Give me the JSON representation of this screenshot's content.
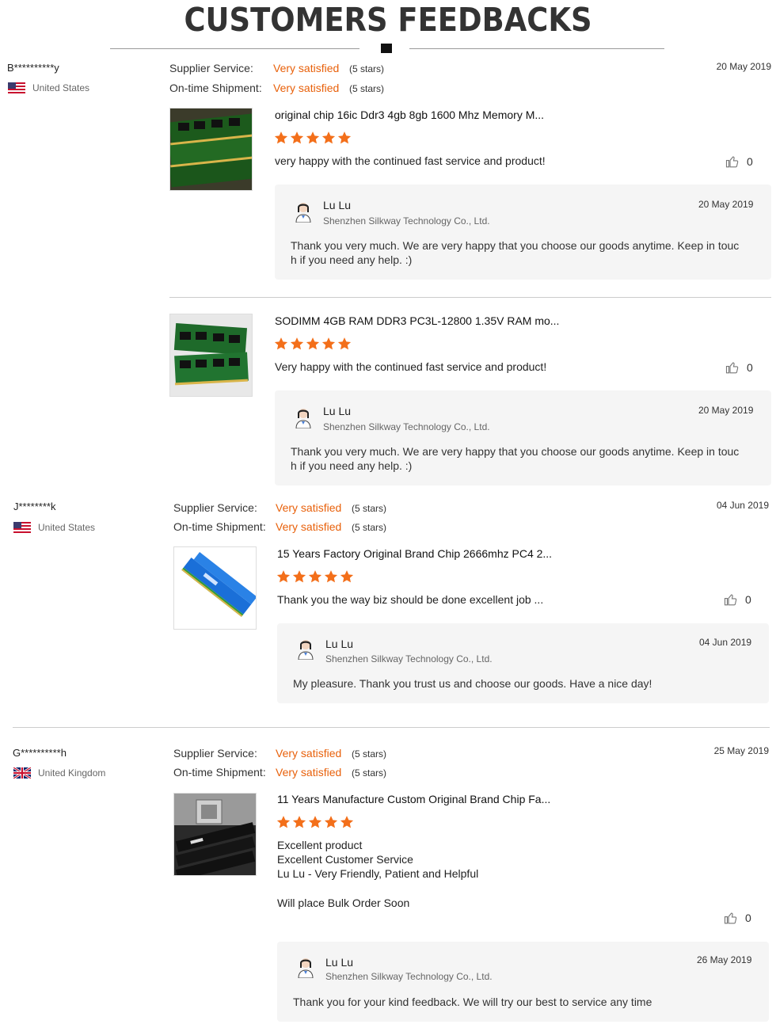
{
  "page_title": "CUSTOMERS FEEDBACKS",
  "labels": {
    "supplier_service": "Supplier Service:",
    "ontime_shipment": "On-time Shipment:"
  },
  "colors": {
    "accent": "#e8600a",
    "star": "#f36f1a"
  },
  "reviews": [
    {
      "name": "B**********y",
      "country": "United States",
      "flag": "us-flag-icon",
      "supplier_value": "Very satisfied",
      "supplier_stars": "(5 stars)",
      "shipment_value": "Very satisfied",
      "shipment_stars": "(5 stars)",
      "date": "20 May 2019",
      "rating": 5,
      "products": [
        {
          "title": "original chip 16ic Ddr3 4gb 8gb 1600 Mhz Memory M...",
          "image": "green-desktop-ram-image",
          "text": "very happy with the continued fast service and product!",
          "likes": "0",
          "reply": {
            "name": "Lu Lu",
            "company": "Shenzhen Silkway Technology Co., Ltd.",
            "date": "20 May 2019",
            "text1": "Thank you very much.  We are very happy that you choose our goods anytime. Keep in touc",
            "text2": "h if you need any help. :)"
          }
        },
        {
          "title": "SODIMM 4GB RAM DDR3 PC3L-12800 1.35V RAM mo...",
          "image": "green-laptop-ram-image",
          "text": "Very happy with the continued fast service and product!",
          "likes": "0",
          "reply": {
            "name": "Lu Lu",
            "company": "Shenzhen Silkway Technology Co., Ltd.",
            "date": "20 May 2019",
            "text1": "Thank you very much.  We are very happy that you choose our goods anytime. Keep in touc",
            "text2": "h if you need any help. :)"
          }
        }
      ]
    },
    {
      "name": "J********k",
      "country": "United States",
      "flag": "us-flag-icon",
      "supplier_value": "Very satisfied",
      "supplier_stars": "(5 stars)",
      "shipment_value": "Very satisfied",
      "shipment_stars": "(5 stars)",
      "date": "04 Jun 2019",
      "rating": 5,
      "products": [
        {
          "title": "15 Years Factory Original Brand Chip 2666mhz PC4 2...",
          "image": "blue-heatsink-ram-image",
          "text": "Thank you the way biz should be done excellent job ...",
          "likes": "0",
          "reply": {
            "name": "Lu Lu",
            "company": "Shenzhen Silkway Technology Co., Ltd.",
            "date": "04 Jun 2019",
            "text1": "My pleasure. Thank you trust us and choose our goods. Have a nice day!",
            "text2": ""
          }
        }
      ]
    },
    {
      "name": "G**********h",
      "country": "United Kingdom",
      "flag": "uk-flag-icon",
      "supplier_value": "Very satisfied",
      "supplier_stars": "(5 stars)",
      "shipment_value": "Very satisfied",
      "shipment_stars": "(5 stars)",
      "date": "25 May 2019",
      "rating": 5,
      "products": [
        {
          "title": "11 Years Manufacture Custom Original Brand Chip Fa...",
          "image": "black-ram-motherboard-image",
          "text_lines": [
            "Excellent product",
            "Excellent Customer Service",
            "Lu Lu - Very Friendly, Patient and Helpful",
            "",
            "Will place Bulk Order Soon"
          ],
          "likes": "0",
          "reply": {
            "name": "Lu Lu",
            "company": "Shenzhen Silkway Technology Co., Ltd.",
            "date": "26 May 2019",
            "text1": "Thank you for your kind feedback. We will try our best to service any time",
            "text2": ""
          }
        }
      ]
    }
  ]
}
